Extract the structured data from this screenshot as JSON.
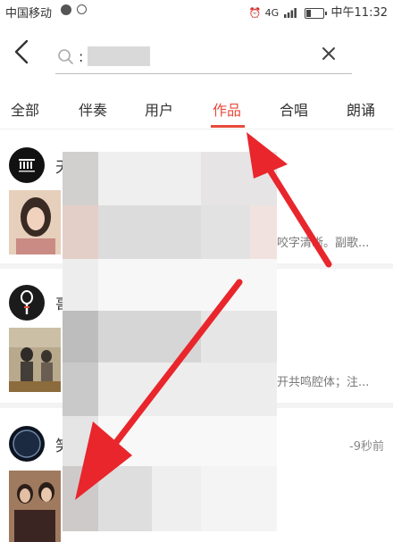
{
  "status_bar": {
    "carrier": "中国移动",
    "network": "4G",
    "clock": "中午11:32"
  },
  "search": {
    "query": ":",
    "placeholder": ""
  },
  "tabs": [
    {
      "label": "全部",
      "active": false
    },
    {
      "label": "伴奏",
      "active": false
    },
    {
      "label": "用户",
      "active": false
    },
    {
      "label": "作品",
      "active": true
    },
    {
      "label": "合唱",
      "active": false
    },
    {
      "label": "朗诵",
      "active": false
    }
  ],
  "results": [
    {
      "user": "天",
      "desc": "咬字清晰。副歌...",
      "time": ""
    },
    {
      "user": "哥",
      "desc": "开共鸣腔体；注...",
      "time": ""
    },
    {
      "user": "笑",
      "desc": "",
      "time": "-9秒前"
    }
  ],
  "colors": {
    "accent": "#e84b3c",
    "arrow": "#e8262c"
  }
}
